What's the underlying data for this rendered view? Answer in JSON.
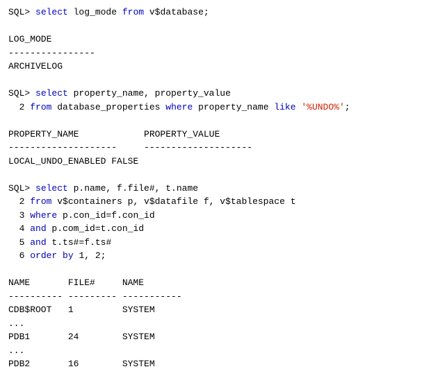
{
  "terminal": {
    "lines": [
      {
        "type": "sql",
        "content": "SQL> select log_mode from v$database;"
      },
      {
        "type": "blank"
      },
      {
        "type": "output",
        "content": "LOG_MODE"
      },
      {
        "type": "divider",
        "content": "----------------"
      },
      {
        "type": "output",
        "content": "ARCHIVELOG"
      },
      {
        "type": "blank"
      },
      {
        "type": "sql",
        "content": "SQL> select property_name, property_value"
      },
      {
        "type": "sql-cont",
        "content": "  2 from database_properties where property_name like '%UNDO%';"
      },
      {
        "type": "blank"
      },
      {
        "type": "output-cols",
        "content": "PROPERTY_NAME            PROPERTY_VALUE"
      },
      {
        "type": "divider",
        "content": "--------------------     --------------------"
      },
      {
        "type": "output",
        "content": "LOCAL_UNDO_ENABLED FALSE"
      },
      {
        "type": "blank"
      },
      {
        "type": "sql",
        "content": "SQL> select p.name, f.file#, t.name"
      },
      {
        "type": "sql-cont",
        "content": "  2 from v$containers p, v$datafile f, v$tablespace t"
      },
      {
        "type": "sql-cont",
        "content": "  3 where p.con_id=f.con_id"
      },
      {
        "type": "sql-cont",
        "content": "  4 and p.com_id=t.con_id"
      },
      {
        "type": "sql-cont",
        "content": "  5 and t.ts#=f.ts#"
      },
      {
        "type": "sql-cont",
        "content": "  6 order by 1, 2;"
      },
      {
        "type": "blank"
      },
      {
        "type": "output-cols",
        "content": "NAME       FILE#     NAME"
      },
      {
        "type": "divider",
        "content": "---------- --------- -----------"
      },
      {
        "type": "output",
        "content": "CDB$ROOT   1         SYSTEM"
      },
      {
        "type": "output",
        "content": "..."
      },
      {
        "type": "output",
        "content": "PDB1       24        SYSTEM"
      },
      {
        "type": "output",
        "content": "..."
      },
      {
        "type": "output",
        "content": "PDB2       16        SYSTEM"
      }
    ]
  }
}
